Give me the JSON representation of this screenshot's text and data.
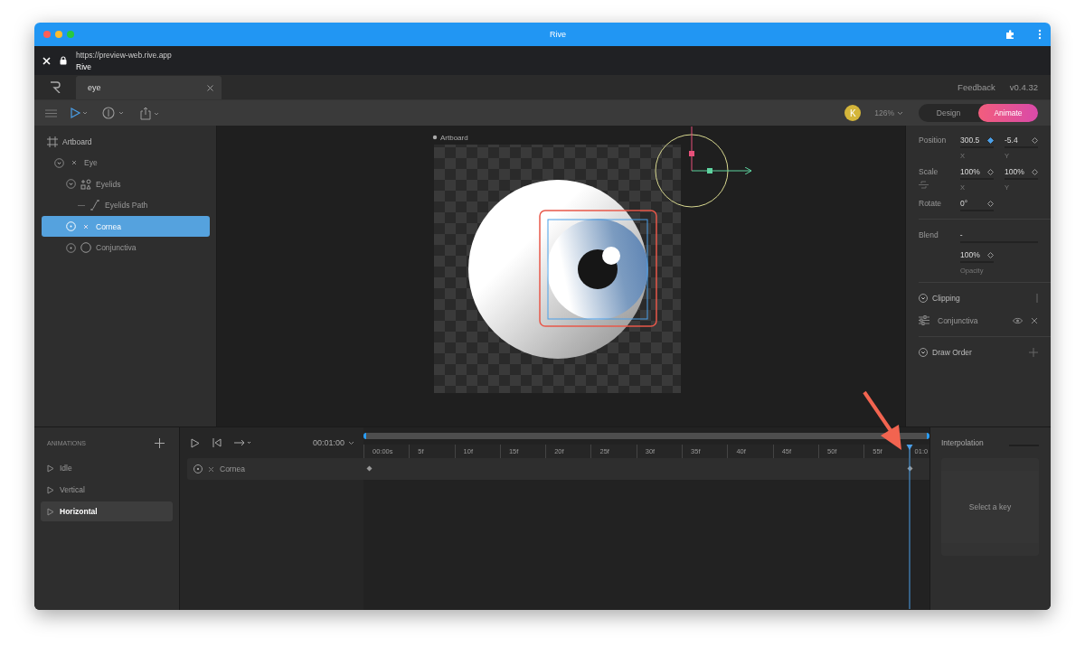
{
  "window": {
    "title": "Rive"
  },
  "browser": {
    "url": "https://preview-web.rive.app",
    "page_title": "Rive"
  },
  "tabs": [
    {
      "label": "eye",
      "selected": true
    }
  ],
  "header_links": [
    "Feedback",
    "v0.4.32"
  ],
  "toolbar": {
    "avatar": "K",
    "zoom": "126%",
    "modes": [
      {
        "label": "Design",
        "selected": false
      },
      {
        "label": "Animate",
        "selected": true
      }
    ]
  },
  "hierarchy": [
    {
      "label": "Artboard",
      "kind": "artboard",
      "children": [
        {
          "label": "Eye",
          "kind": "group",
          "expanded": true,
          "selected": false,
          "children": [
            {
              "label": "Eyelids",
              "kind": "shape",
              "expanded": true,
              "selected": false,
              "children": [
                {
                  "label": "Eyelids Path",
                  "kind": "path",
                  "selected": false
                }
              ]
            },
            {
              "label": "Cornea",
              "kind": "group",
              "expanded": false,
              "selected": true
            },
            {
              "label": "Conjunctiva",
              "kind": "ellipse",
              "expanded": false,
              "selected": false
            }
          ]
        }
      ]
    }
  ],
  "stage": {
    "artboard_label": "Artboard"
  },
  "properties": {
    "transform": [
      {
        "label": "Position",
        "fields": [
          {
            "value": "300.5",
            "caption": "X",
            "keyed": true
          },
          {
            "value": "-5.4",
            "caption": "Y",
            "keyed": false
          }
        ]
      },
      {
        "label": "Scale",
        "fields": [
          {
            "value": "100%",
            "caption": "X",
            "keyed": false
          },
          {
            "value": "100%",
            "caption": "Y",
            "keyed": false
          }
        ]
      },
      {
        "label": "Rotate",
        "fields": [
          {
            "value": "0°",
            "keyed": false
          }
        ]
      }
    ],
    "blend": {
      "label": "Blend",
      "value": "-"
    },
    "opacity": {
      "value": "100%",
      "caption": "Opacity",
      "keyed": false
    },
    "clipping": {
      "title": "Clipping",
      "items": [
        "Conjunctiva"
      ]
    },
    "draw_order": {
      "title": "Draw Order"
    }
  },
  "animations": {
    "title": "ANIMATIONS",
    "items": [
      {
        "label": "Idle",
        "selected": false
      },
      {
        "label": "Vertical",
        "selected": false
      },
      {
        "label": "Horizontal",
        "selected": true
      }
    ]
  },
  "timeline": {
    "duration": "00:01:00",
    "ruler": [
      "00:00s",
      "5f",
      "10f",
      "15f",
      "20f",
      "25f",
      "30f",
      "35f",
      "40f",
      "45f",
      "50f",
      "55f",
      "01:0"
    ],
    "tracks": [
      {
        "label": "Cornea"
      }
    ]
  },
  "interpolation": {
    "title": "Interpolation",
    "empty": "Select a key"
  }
}
